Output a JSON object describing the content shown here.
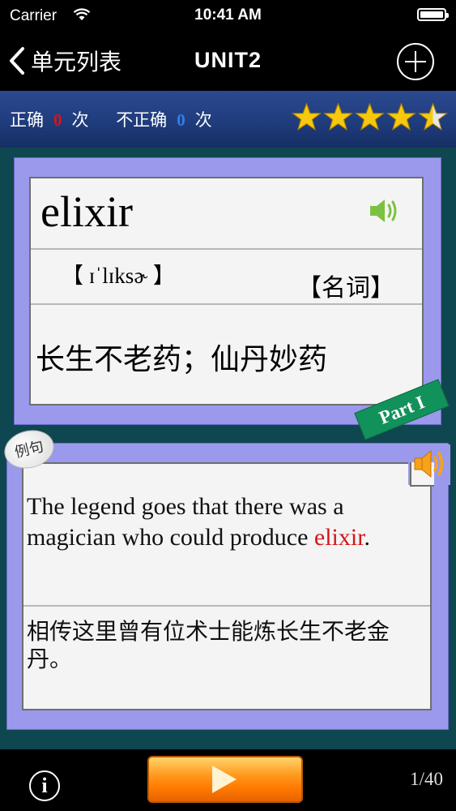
{
  "status_bar": {
    "carrier": "Carrier",
    "time": "10:41 AM"
  },
  "nav": {
    "back_label": "单元列表",
    "title": "UNIT2"
  },
  "stats": {
    "correct_label": "正确",
    "correct_count": "0",
    "incorrect_label": "不正确",
    "incorrect_count": "0",
    "unit_label": "次",
    "rating": 4.5,
    "rating_max": 5
  },
  "word_card": {
    "word": "elixir",
    "phonetic": "【 ɪˈlɪksɚ 】",
    "part_of_speech": "【名词】",
    "definition": "长生不老药；仙丹妙药"
  },
  "part_badge": "Part I",
  "example": {
    "tag": "例句",
    "sentence_before": "The legend goes that there was a magician who could produce ",
    "sentence_highlight": "elixir",
    "sentence_after": ".",
    "translation": "相传这里曾有位术士能炼长生不老金丹。"
  },
  "bottom": {
    "info_label": "i",
    "page_counter": "1/40"
  },
  "icons": {
    "back": "chevron-left-icon",
    "add": "plus-circle-icon",
    "star": "star-icon",
    "speaker": "speaker-icon",
    "info": "info-icon",
    "play": "play-icon",
    "wifi": "wifi-icon",
    "battery": "battery-icon"
  },
  "colors": {
    "star_gold": "#f6c90e",
    "card_purple": "#9a99ec",
    "badge_green": "#11925a",
    "highlight_red": "#d4161a",
    "play_orange": "#ff8a00"
  }
}
